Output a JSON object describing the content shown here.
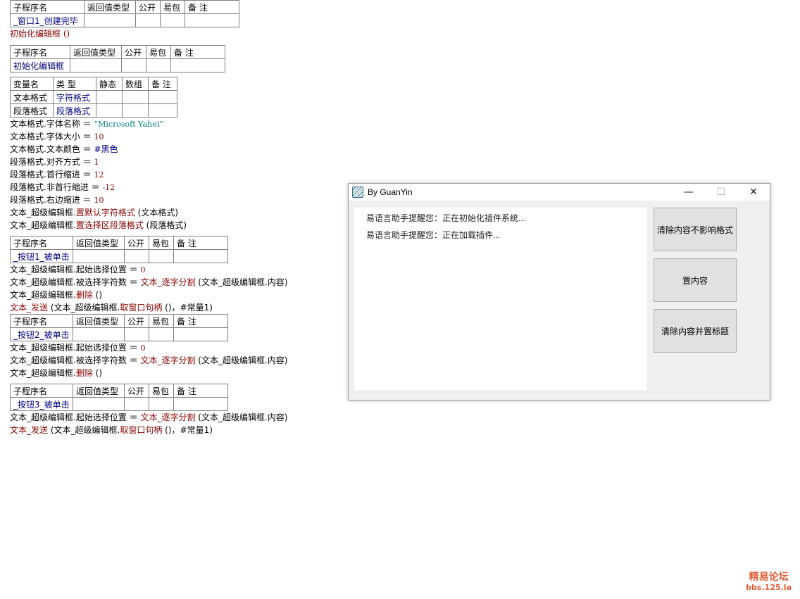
{
  "headers": {
    "sub": [
      "子程序名",
      "返回值类型",
      "公开",
      "易包",
      "备 注"
    ],
    "var": [
      "变量名",
      "类 型",
      "静态",
      "数组",
      "备 注"
    ]
  },
  "block1": {
    "name": "_窗口1_创建完毕",
    "call": "初始化编辑框 ()"
  },
  "block2": {
    "name": "初始化编辑框",
    "vars": [
      {
        "name": "文本格式",
        "type": "字符格式"
      },
      {
        "name": "段落格式",
        "type": "段落格式"
      }
    ],
    "lines": [
      {
        "l": "文本格式.字体名称 ＝ ",
        "v": "“Microsoft Yahei”"
      },
      {
        "l": "文本格式.字体大小 ＝ ",
        "v": "10"
      },
      {
        "l": "文本格式.文本颜色 ＝ ",
        "v": "#黑色"
      },
      {
        "l": "段落格式.对齐方式 ＝ ",
        "v": "1"
      },
      {
        "l": "段落格式.首行缩进 ＝ ",
        "v": "12"
      },
      {
        "l": "段落格式.非首行缩进 ＝ ",
        "v": "-12"
      },
      {
        "l": "段落格式.右边缩进 ＝ ",
        "v": "10"
      }
    ],
    "calls": [
      {
        "l": "文本_超级编辑框.",
        "f": "置默认字符格式",
        "a": " (文本格式)"
      },
      {
        "l": "文本_超级编辑框.",
        "f": "置选择区段落格式",
        "a": " (段落格式)"
      }
    ]
  },
  "block3": {
    "name": "_按钮1_被单击",
    "l1": {
      "l": "文本_超级编辑框.起始选择位置 ＝ ",
      "v": "0"
    },
    "l2": {
      "l": "文本_超级编辑框.被选择字符数 ＝ ",
      "f": "文本_逐字分割",
      "a": " (文本_超级编辑框.内容)"
    },
    "l3": {
      "l": "文本_超级编辑框.",
      "f": "删除",
      "a": " ()"
    },
    "l4": {
      "f": "文本_发送",
      "a1": " (文本_超级编辑框.",
      "f2": "取窗口句柄",
      "a2": " ()，#常量1)"
    }
  },
  "block4": {
    "name": "_按钮2_被单击",
    "l1": {
      "l": "文本_超级编辑框.起始选择位置 ＝ ",
      "v": "0"
    },
    "l2": {
      "l": "文本_超级编辑框.被选择字符数 ＝ ",
      "f": "文本_逐字分割",
      "a": " (文本_超级编辑框.内容)"
    },
    "l3": {
      "l": "文本_超级编辑框.",
      "f": "删除",
      "a": " ()"
    }
  },
  "block5": {
    "name": "_按钮3_被单击",
    "l1": {
      "l": "文本_超级编辑框.起始选择位置 ＝ ",
      "f": "文本_逐字分割",
      "a": " (文本_超级编辑框.内容)"
    },
    "l2": {
      "f": "文本_发送",
      "a1": " (文本_超级编辑框.",
      "f2": "取窗口句柄",
      "a2": " ()，#常量1)"
    }
  },
  "dialog": {
    "title": "By GuanYin",
    "messages": [
      "易语言助手提醒您：正在初始化插件系统...",
      "易语言助手提醒您：正在加载插件..."
    ],
    "buttons": [
      "清除内容不影响格式",
      "置内容",
      "清除内容并置标题"
    ]
  },
  "watermark": {
    "line1": "精易论坛",
    "line2": "bbs.125.la"
  }
}
